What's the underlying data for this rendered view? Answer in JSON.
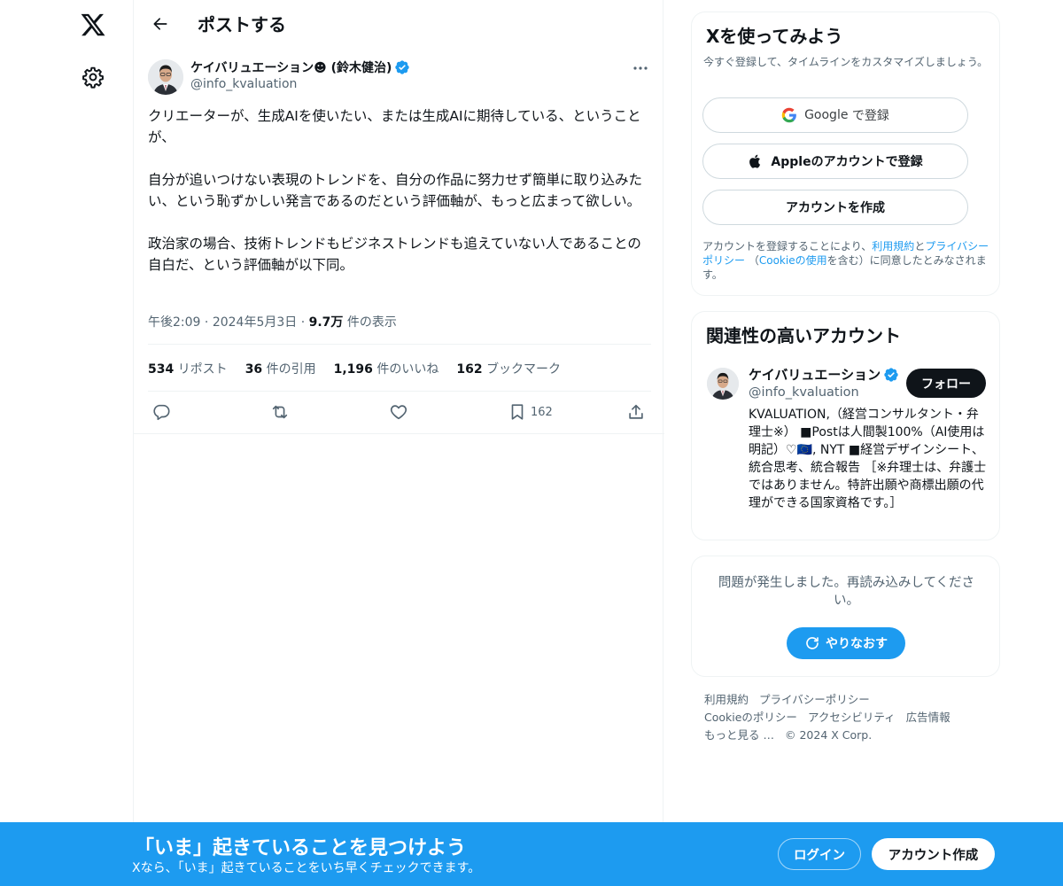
{
  "colors": {
    "accent": "#1d9bf0",
    "text": "#0f1419",
    "muted": "#536471",
    "border": "#eff3f4"
  },
  "nav": {
    "logo_icon": "x-logo-icon",
    "settings_icon": "gear-icon"
  },
  "post_header": {
    "title": "ポストする"
  },
  "author": {
    "name": "ケイバリュエーション☻ (鈴木健治)",
    "handle": "@info_kvaluation"
  },
  "post": {
    "text": "クリエーターが、生成AIを使いたい、または生成AIに期待している、ということが、\n\n自分が追いつけない表現のトレンドを、自分の作品に努力せず簡単に取り込みたい、という恥ずかしい発言であるのだという評価軸が、もっと広まって欲しい。\n\n政治家の場合、技術トレンドもビジネストレンドも追えていない人であることの自白だ、という評価軸が以下同。",
    "time": "午後2:09",
    "date": "2024年5月3日",
    "views_count": "9.7万",
    "views_label": "件の表示"
  },
  "stats": {
    "reposts_count": "534",
    "reposts_label": "リポスト",
    "quotes_count": "36",
    "quotes_label": "件の引用",
    "likes_count": "1,196",
    "likes_label": "件のいいね",
    "bookmarks_count": "162",
    "bookmarks_label": "ブックマーク"
  },
  "actions": {
    "bookmark_count": "162"
  },
  "signup": {
    "title": "Xを使ってみよう",
    "subtitle": "今すぐ登録して、タイムラインをカスタマイズしましょう。",
    "google_brand": "Google",
    "google_label": "で登録",
    "apple_label": "Appleのアカウントで登録",
    "create_label": "アカウントを作成",
    "terms_pre": "アカウントを登録することにより、",
    "terms_link": "利用規約",
    "terms_and": "と",
    "privacy_link": "プライバシーポリシー",
    "terms_mid": "（",
    "cookie_link": "Cookieの使用",
    "terms_post": "を含む）に同意したとみなされます。"
  },
  "related": {
    "title": "関連性の高いアカウント",
    "name": "ケイバリュエーション",
    "handle": "@info_kvaluation",
    "follow_label": "フォロー",
    "bio": "KVALUATION,（経営コンサルタント・弁理士※） ■Postは人間製100%（AI使用は明記）♡🇪🇺, NYT ■経営デザインシート、統合思考、統合報告 ［※弁理士は、弁護士ではありません。特許出願や商標出願の代理ができる国家資格です。］"
  },
  "error": {
    "message": "問題が発生しました。再読み込みしてください。",
    "retry_label": "やりなおす"
  },
  "footer": {
    "terms": "利用規約",
    "privacy": "プライバシーポリシー",
    "cookie": "Cookieのポリシー",
    "accessibility": "アクセシビリティ",
    "ads": "広告情報",
    "more": "もっと見る …",
    "copyright": "© 2024 X Corp."
  },
  "banner": {
    "title": "「いま」起きていることを見つけよう",
    "subtitle": "Xなら、「いま」起きていることをいち早くチェックできます。",
    "login_label": "ログイン",
    "signup_label": "アカウント作成"
  }
}
